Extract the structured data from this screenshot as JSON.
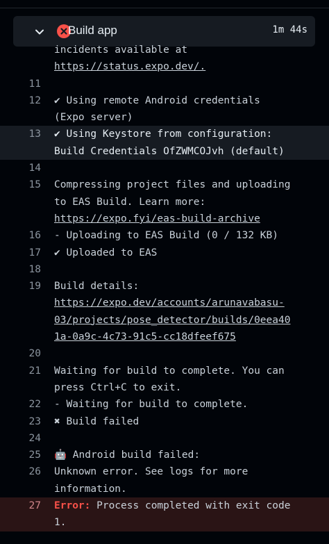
{
  "step": {
    "title": "Build app",
    "duration": "1m 44s"
  },
  "log": [
    {
      "num": "",
      "lines": [
        "incidents available at"
      ]
    },
    {
      "num": "",
      "lines": [
        "https://status.expo.dev/."
      ],
      "link": true
    },
    {
      "num": "11",
      "lines": [
        ""
      ]
    },
    {
      "num": "12",
      "lines": [
        "✔ Using remote Android credentials",
        "(Expo server)"
      ]
    },
    {
      "num": "13",
      "lines": [
        "✔ Using Keystore from configuration:",
        "Build Credentials OfZWMCOJvh (default)"
      ],
      "highlight": true
    },
    {
      "num": "14",
      "lines": [
        ""
      ]
    },
    {
      "num": "15",
      "lines": [
        "Compressing project files and uploading",
        "to EAS Build. Learn more:"
      ]
    },
    {
      "num": "",
      "lines": [
        "https://expo.fyi/eas-build-archive"
      ],
      "link": true
    },
    {
      "num": "16",
      "lines": [
        "- Uploading to EAS Build (0 / 132 KB)"
      ]
    },
    {
      "num": "17",
      "lines": [
        "✔ Uploaded to EAS"
      ]
    },
    {
      "num": "18",
      "lines": [
        ""
      ]
    },
    {
      "num": "19",
      "lines": [
        "Build details:"
      ]
    },
    {
      "num": "",
      "lines": [
        "https://expo.dev/accounts/arunavabasu-",
        "03/projects/pose_detector/builds/0eea40",
        "1a-0a9c-4c73-91c5-cc18dfeef675"
      ],
      "link": true
    },
    {
      "num": "20",
      "lines": [
        ""
      ]
    },
    {
      "num": "21",
      "lines": [
        "Waiting for build to complete. You can",
        "press Ctrl+C to exit."
      ]
    },
    {
      "num": "22",
      "lines": [
        "- Waiting for build to complete."
      ]
    },
    {
      "num": "23",
      "lines": [
        "✖ Build failed"
      ]
    },
    {
      "num": "24",
      "lines": [
        ""
      ]
    },
    {
      "num": "25",
      "lines": [
        "🤖 Android build failed:"
      ]
    },
    {
      "num": "26",
      "lines": [
        "Unknown error. See logs for more",
        "information."
      ]
    },
    {
      "num": "27",
      "error_label": "Error:",
      "lines": [
        " Process completed with exit code",
        "1."
      ],
      "error": true
    }
  ]
}
